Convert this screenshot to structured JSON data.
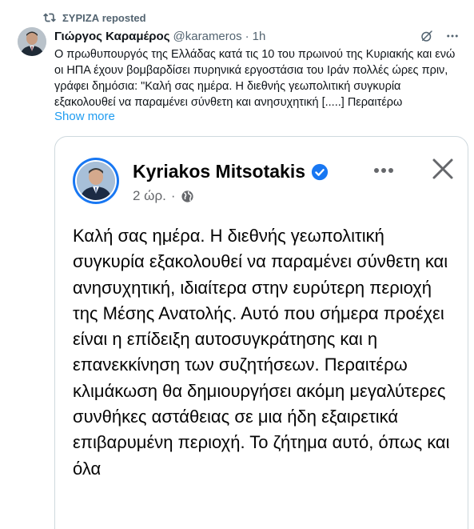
{
  "repost": {
    "label": "ΣΥΡΙΖΑ reposted",
    "icon": "repost-icon"
  },
  "tweet": {
    "author_name": "Γιώργος Καραμέρος",
    "handle": "@karameros",
    "separator": "·",
    "time": "1h",
    "text": "Ο πρωθυπουργός της Ελλάδας κατά τις 10 του πρωινού της Κυριακής και ενώ οι ΗΠΑ έχουν βομβαρδίσει πυρηνικά εργοστάσια του Ιράν πολλές ώρες πριν, γράφει δημόσια: \"Καλή σας ημέρα. Η διεθνής γεωπολιτική συγκυρία εξακολουθεί να παραμένει σύνθετη και ανησυχητική [.....] Περαιτέρω",
    "show_more": "Show more",
    "icons": [
      "grok-icon",
      "more-icon"
    ]
  },
  "embedded_post": {
    "author_name": "Kyriakos Mitsotakis",
    "time": "2 ώρ.",
    "separator": "·",
    "text": "Καλή σας ημέρα. Η διεθνής γεωπολιτική συγκυρία εξακολουθεί να παραμένει σύνθετη και ανησυχητική, ιδιαίτερα στην ευρύτερη περιοχή της Μέσης Ανατολής. Αυτό που σήμερα προέχει είναι η επίδειξη αυτοσυγκράτησης και η επανεκκίνηση των συζητήσεων. Περαιτέρω κλιμάκωση θα δημιουργήσει ακόμη μεγαλύτερες συνθήκες αστάθειας σε μια ήδη εξαιρετικά επιβαρυμένη περιοχή. Το ζήτημα αυτό, όπως και όλα",
    "icons": [
      "verified-icon",
      "globe-icon",
      "more-dots-icon",
      "close-icon"
    ]
  },
  "colors": {
    "text": "#0f1419",
    "secondary": "#536471",
    "link": "#1d9bf0",
    "border": "#cfd9de",
    "verified": "#1877f2",
    "fb_secondary": "#65676b"
  }
}
